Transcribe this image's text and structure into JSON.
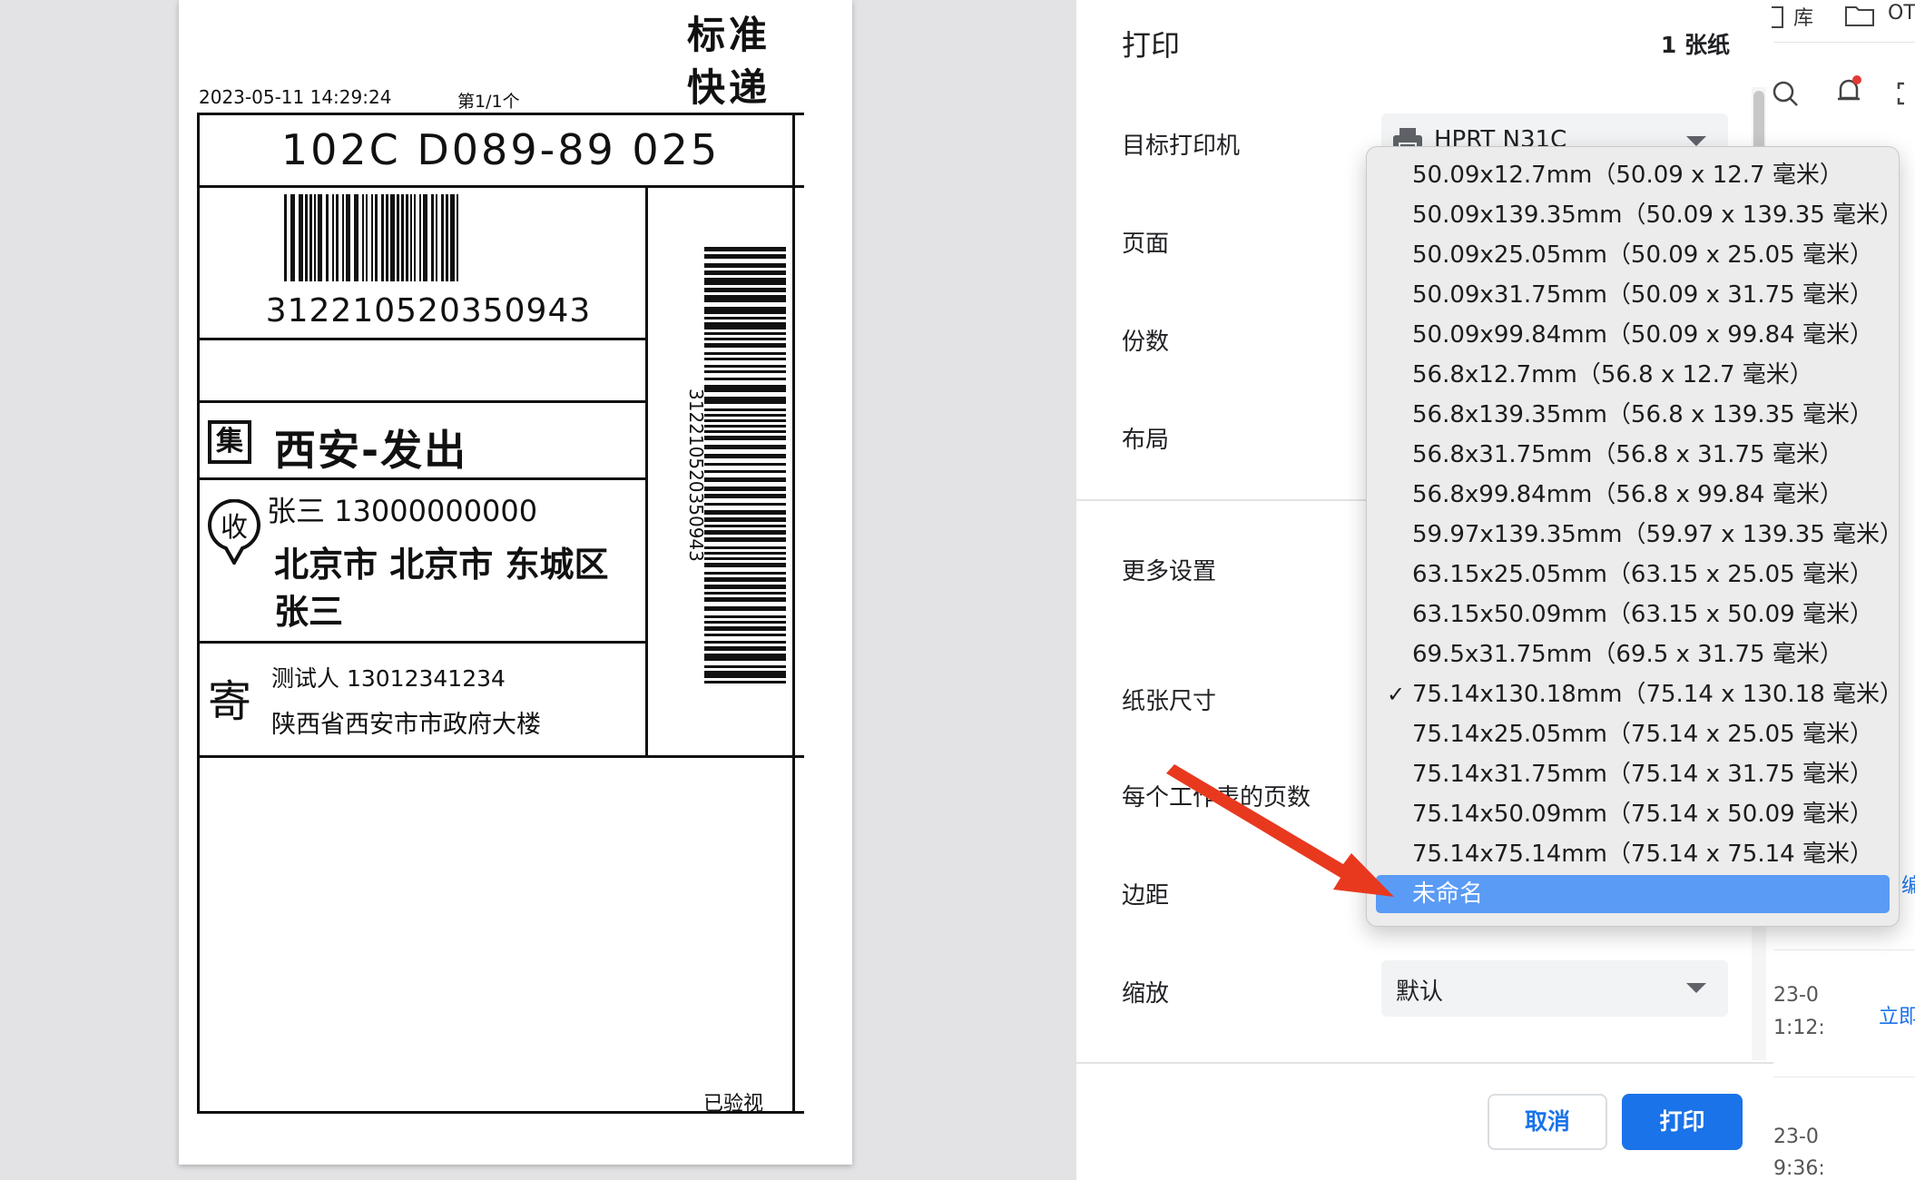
{
  "label": {
    "brand_line1": "标准",
    "brand_line2": "快递",
    "date": "2023-05-11 14:29:24",
    "page_no": "第1/1个",
    "route_code": "102C D089-89 025",
    "tracking_number": "312210520350943",
    "tracking_vertical": "312210520350943",
    "ji_badge": "集",
    "origin": "西安-发出",
    "shou_badge": "收",
    "receiver_name_phone": "张三 13000000000",
    "receiver_address_line1": "北京市 北京市 东城区",
    "receiver_address_line2": "张三",
    "ji2_char": "寄",
    "sender_name_phone": "测试人 13012341234",
    "sender_address": "陕西省西安市市政府大楼",
    "checked": "已验视"
  },
  "dialog": {
    "title": "打印",
    "sheet_count": "1 张纸",
    "rows": {
      "printer": "目标打印机",
      "pages": "页面",
      "copies": "份数",
      "layout": "布局",
      "more_settings": "更多设置",
      "paper_size": "纸张尺寸",
      "pages_per_sheet": "每个工作表的页数",
      "margins": "边距",
      "scale": "缩放"
    },
    "printer_value": "HPRT N31C",
    "scale_value": "默认",
    "cancel_label": "取消",
    "print_label": "打印"
  },
  "paper_menu": {
    "items": [
      "50.09x12.7mm（50.09 x 12.7 毫米）",
      "50.09x139.35mm（50.09 x 139.35 毫米）",
      "50.09x25.05mm（50.09 x 25.05 毫米）",
      "50.09x31.75mm（50.09 x 31.75 毫米）",
      "50.09x99.84mm（50.09 x 99.84 毫米）",
      "56.8x12.7mm（56.8 x 12.7 毫米）",
      "56.8x139.35mm（56.8 x 139.35 毫米）",
      "56.8x31.75mm（56.8 x 31.75 毫米）",
      "56.8x99.84mm（56.8 x 99.84 毫米）",
      "59.97x139.35mm（59.97 x 139.35 毫米）",
      "63.15x25.05mm（63.15 x 25.05 毫米）",
      "63.15x50.09mm（63.15 x 50.09 毫米）",
      "69.5x31.75mm（69.5 x 31.75 毫米）",
      "75.14x130.18mm（75.14 x 130.18 毫米）",
      "75.14x25.05mm（75.14 x 25.05 毫米）",
      "75.14x31.75mm（75.14 x 31.75 毫米）",
      "75.14x50.09mm（75.14 x 50.09 毫米）",
      "75.14x75.14mm（75.14 x 75.14 毫米）",
      "未命名"
    ],
    "checked_index": 13,
    "highlighted_index": 18,
    "check_glyph": "✓"
  },
  "background_app": {
    "toolbar_text1": "库",
    "toolbar_text2": "OT",
    "side_link": "编",
    "row1_time_a": "23-0",
    "row1_time_b": "1:12:",
    "row1_link": "立即",
    "row2_time_a": "23-0",
    "row2_time_b": "9:36:"
  },
  "colors": {
    "accent": "#1a73e8",
    "menu_highlight": "#5a9bf6",
    "arrow_red": "#e8391f"
  }
}
